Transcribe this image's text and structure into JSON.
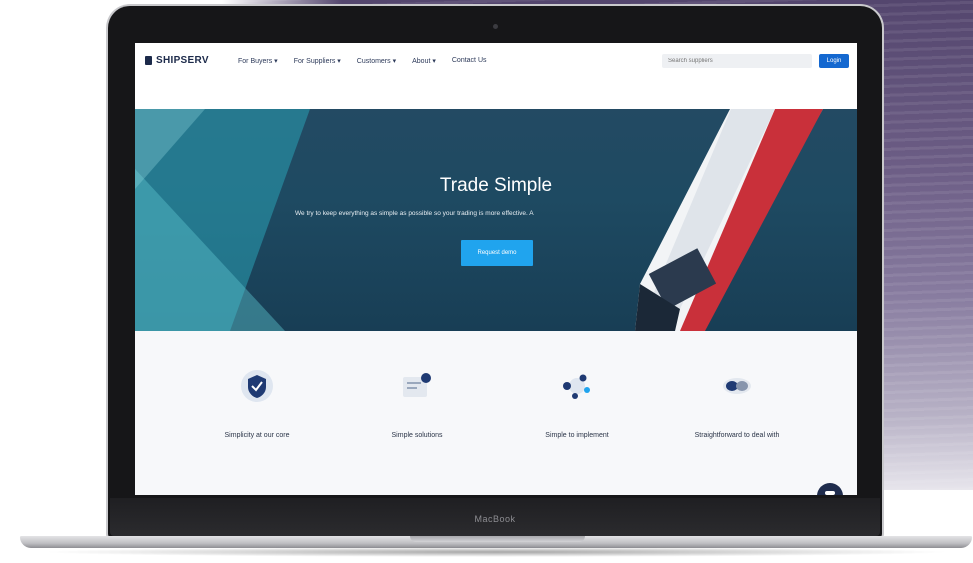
{
  "colors": {
    "brand_navy": "#1c2a4a",
    "accent_blue": "#20a4ee",
    "login_blue": "#1468d0",
    "hero_water": "#1e4a62",
    "features_bg": "#f7f8fa"
  },
  "device": {
    "label": "MacBook"
  },
  "site": {
    "logo_text": "SHIPSERV",
    "nav": [
      {
        "label": "For Buyers ▾"
      },
      {
        "label": "For Suppliers ▾"
      },
      {
        "label": "Customers ▾"
      },
      {
        "label": "About ▾"
      },
      {
        "label": "Contact Us"
      }
    ],
    "search_placeholder": "Search suppliers",
    "login_label": "Login",
    "hero": {
      "title": "Trade Simple",
      "subtitle": "We try to keep everything as simple as possible so your trading is more effective. A",
      "cta_label": "Request demo"
    },
    "features": [
      {
        "icon": "shield-check-icon",
        "label": "Simplicity at our core"
      },
      {
        "icon": "document-icon",
        "label": "Simple solutions"
      },
      {
        "icon": "network-icon",
        "label": "Simple to implement"
      },
      {
        "icon": "handshake-icon",
        "label": "Straightforward to deal with"
      }
    ]
  }
}
